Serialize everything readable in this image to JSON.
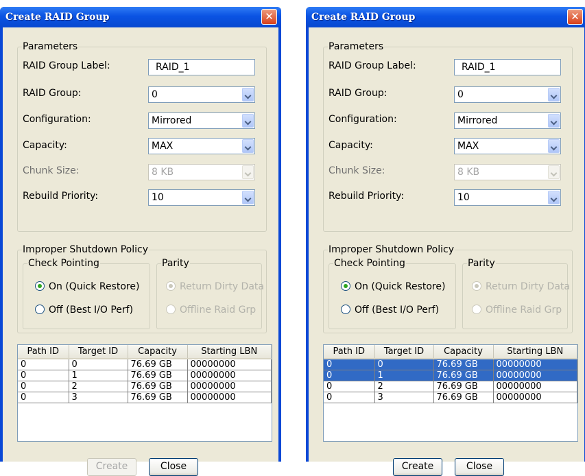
{
  "windows": [
    {
      "title": "Create RAID Group",
      "parameters_legend": "Parameters",
      "labels": {
        "raid_group_label": "RAID Group Label:",
        "raid_group": "RAID Group:",
        "configuration": "Configuration:",
        "capacity": "Capacity:",
        "chunk_size": "Chunk Size:",
        "rebuild_priority": "Rebuild Priority:"
      },
      "values": {
        "raid_group_label": "RAID_1",
        "raid_group": "0",
        "configuration": "Mirrored",
        "capacity": "MAX",
        "chunk_size": "8 KB",
        "rebuild_priority": "10"
      },
      "shutdown_legend": "Improper Shutdown Policy",
      "check_pointing_legend": "Check Pointing",
      "check_on": "On (Quick Restore)",
      "check_off": "Off (Best I/O Perf)",
      "parity_legend": "Parity",
      "parity_return": "Return Dirty Data",
      "parity_offline": "Offline Raid Grp",
      "columns": [
        "Path ID",
        "Target ID",
        "Capacity",
        "Starting LBN"
      ],
      "rows": [
        [
          "0",
          "0",
          "76.69 GB",
          "00000000"
        ],
        [
          "0",
          "1",
          "76.69 GB",
          "00000000"
        ],
        [
          "0",
          "2",
          "76.69 GB",
          "00000000"
        ],
        [
          "0",
          "3",
          "76.69 GB",
          "00000000"
        ]
      ],
      "selected_rows": [],
      "create_label": "Create",
      "create_enabled": false,
      "close_label": "Close"
    },
    {
      "title": "Create RAID Group",
      "parameters_legend": "Parameters",
      "labels": {
        "raid_group_label": "RAID Group Label:",
        "raid_group": "RAID Group:",
        "configuration": "Configuration:",
        "capacity": "Capacity:",
        "chunk_size": "Chunk Size:",
        "rebuild_priority": "Rebuild Priority:"
      },
      "values": {
        "raid_group_label": "RAID_1",
        "raid_group": "0",
        "configuration": "Mirrored",
        "capacity": "MAX",
        "chunk_size": "8 KB",
        "rebuild_priority": "10"
      },
      "shutdown_legend": "Improper Shutdown Policy",
      "check_pointing_legend": "Check Pointing",
      "check_on": "On (Quick Restore)",
      "check_off": "Off (Best I/O Perf)",
      "parity_legend": "Parity",
      "parity_return": "Return Dirty Data",
      "parity_offline": "Offline Raid Grp",
      "columns": [
        "Path ID",
        "Target ID",
        "Capacity",
        "Starting LBN"
      ],
      "rows": [
        [
          "0",
          "0",
          "76.69 GB",
          "00000000"
        ],
        [
          "0",
          "1",
          "76.69 GB",
          "00000000"
        ],
        [
          "0",
          "2",
          "76.69 GB",
          "00000000"
        ],
        [
          "0",
          "3",
          "76.69 GB",
          "00000000"
        ]
      ],
      "selected_rows": [
        0,
        1
      ],
      "create_label": "Create",
      "create_enabled": true,
      "close_label": "Close"
    }
  ],
  "colors": {
    "titlebar": "#0a53e3",
    "selection": "#316ac5",
    "dialog_face": "#ece9d8"
  }
}
